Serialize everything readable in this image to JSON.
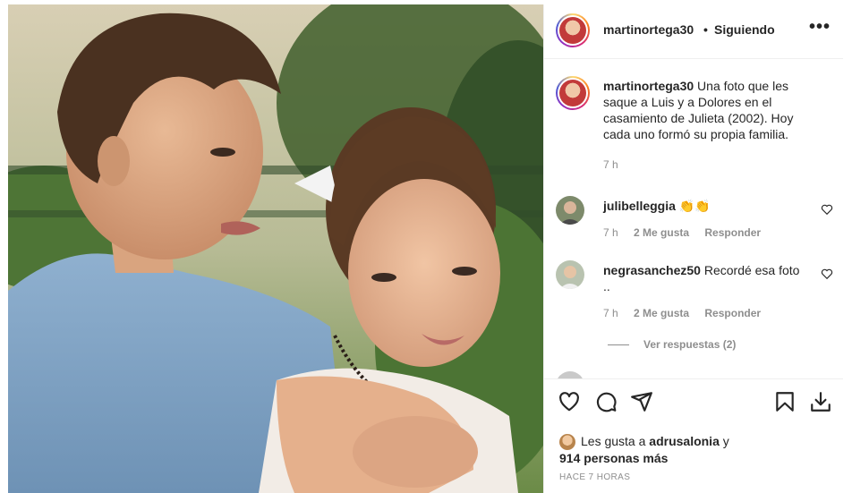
{
  "post": {
    "username": "martinortega30",
    "separator": "•",
    "follow_status": "Siguiendo",
    "more_label": "•••"
  },
  "caption": {
    "username": "martinortega30",
    "text": "Una foto que les saque a Luis y a Dolores en el casamiento de Julieta (2002). Hoy cada uno formó su propia familia.",
    "time": "7 h"
  },
  "comments": [
    {
      "username": "julibelleggia",
      "text": "👏👏",
      "time": "7 h",
      "likes": "2 Me gusta",
      "reply": "Responder"
    },
    {
      "username": "negrasanchez50",
      "text": "Recordé esa foto ..",
      "time": "7 h",
      "likes": "2 Me gusta",
      "reply": "Responder"
    }
  ],
  "view_replies": "Ver respuestas (2)",
  "likes": {
    "prefix": "Les gusta a",
    "user": "adrusalonia",
    "conj": "y",
    "others": "914 personas más"
  },
  "time_ago": "HACE 7 HORAS",
  "icons": [
    "heart-icon",
    "comment-icon",
    "share-icon",
    "bookmark-icon",
    "download-icon",
    "more-icon"
  ],
  "colors": {
    "text": "#262626",
    "secondary": "#8e8e8e",
    "border": "#efefef"
  }
}
